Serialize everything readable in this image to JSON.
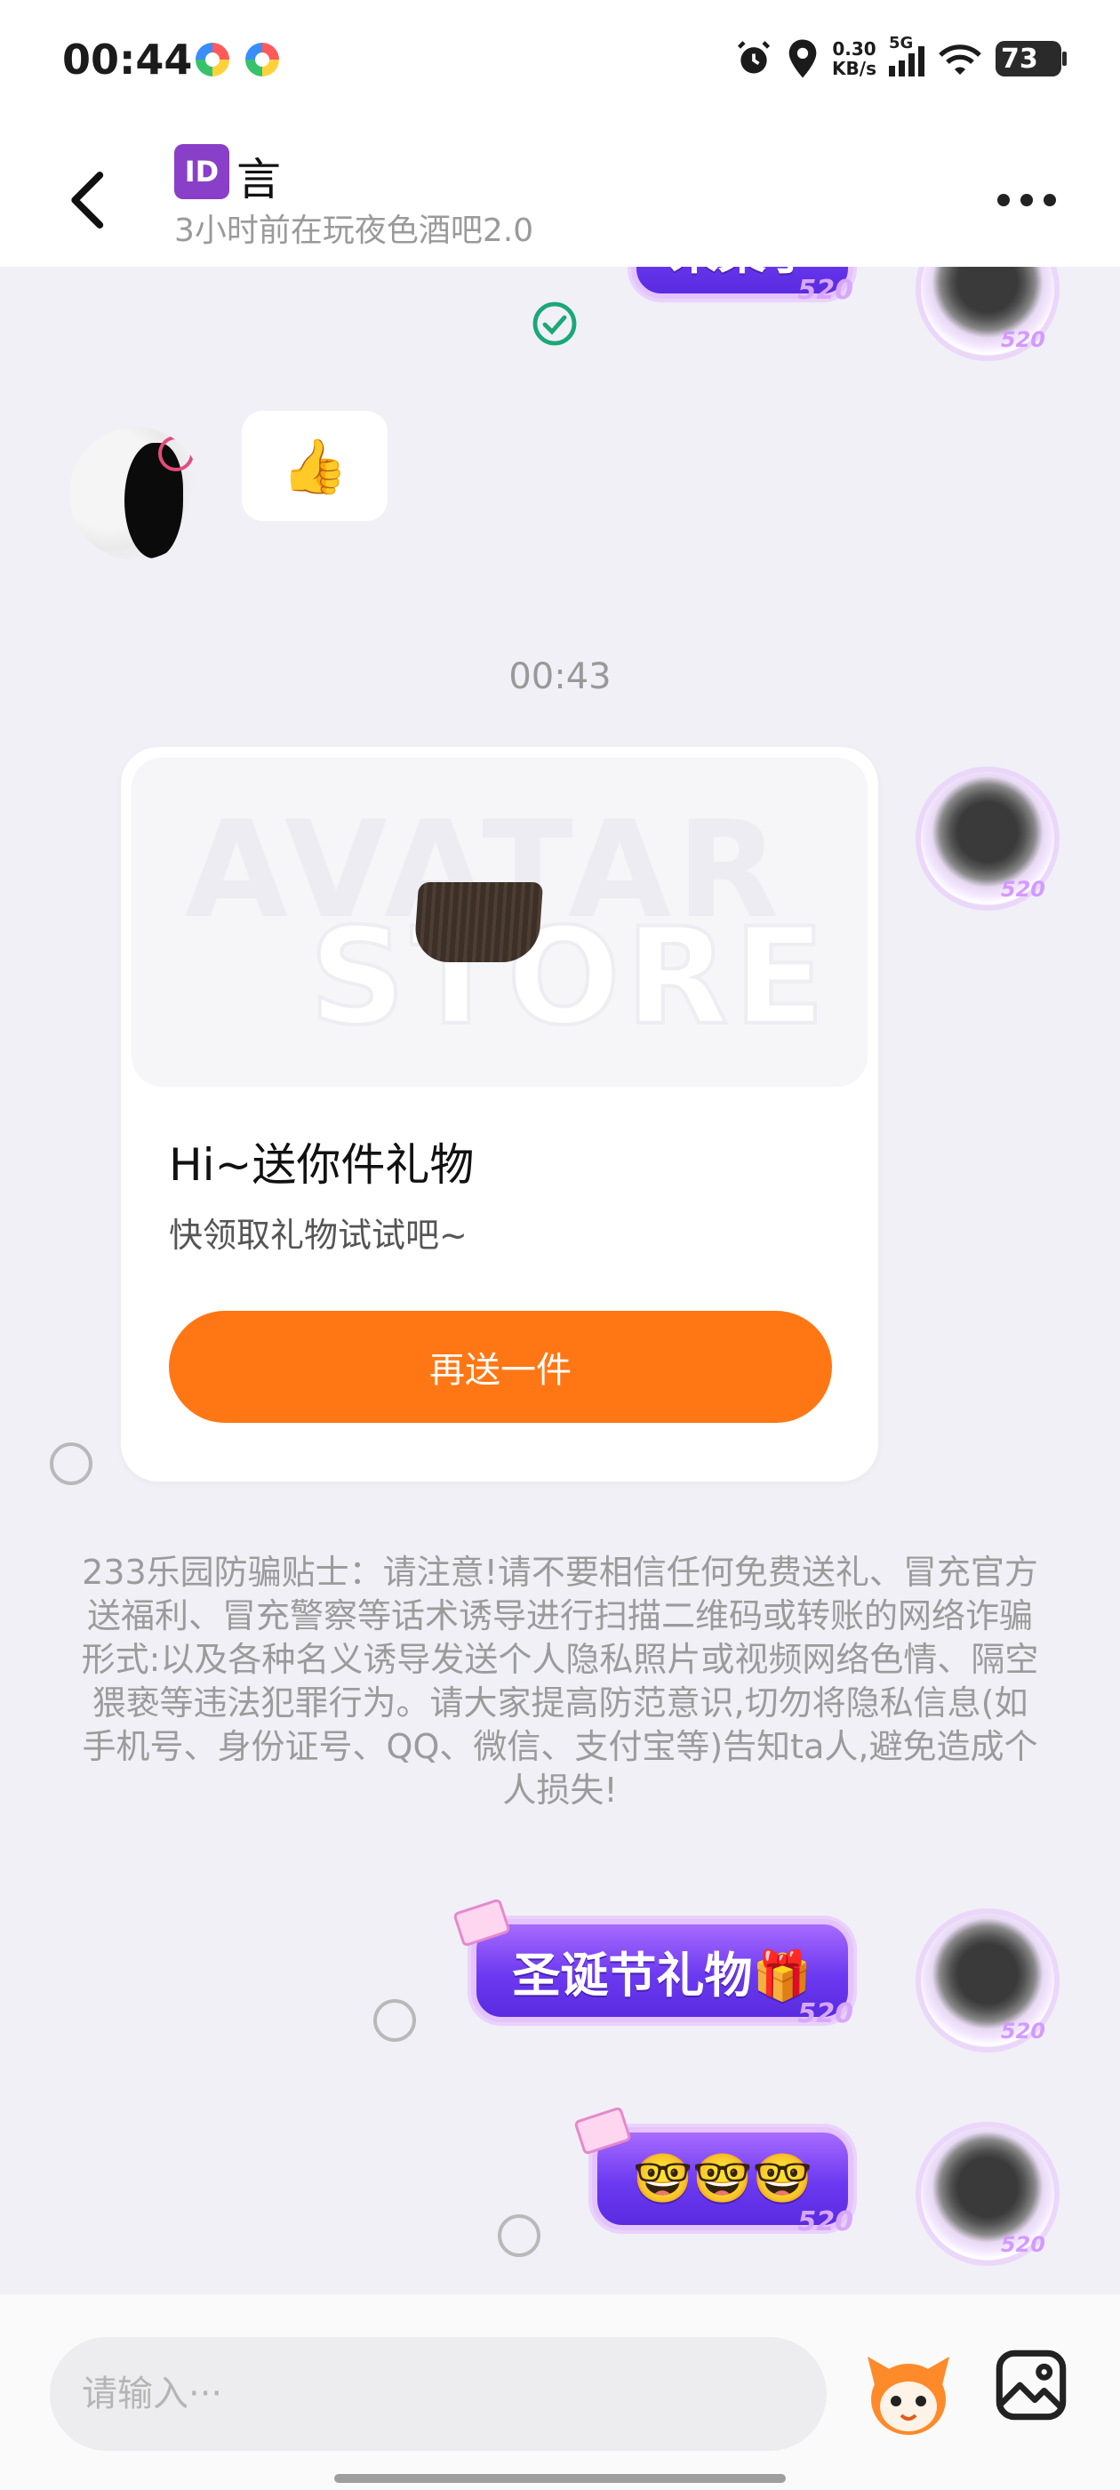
{
  "status_bar": {
    "time": "00:44",
    "net_speed_value": "0.30",
    "net_speed_unit": "KB/s",
    "network_type": "5G",
    "battery": "73"
  },
  "header": {
    "id_badge": "ID",
    "name": "言",
    "subtitle": "3小时前在玩夜色酒吧2.0"
  },
  "messages": {
    "top_pill_partial": "来菜了",
    "thumbs_up": "👍",
    "timestamp": "00:43",
    "gift_card": {
      "watermark_line1": "AVATAR",
      "watermark_line2": "STORE",
      "title": "Hi~送你件礼物",
      "subtitle": "快领取礼物试试吧~",
      "button": "再送一件"
    },
    "anti_fraud_tip": "233乐园防骗贴士：请注意!请不要相信任何免费送礼、冒充官方送福利、冒充警察等话术诱导进行扫描二维码或转账的网络诈骗形式:以及各种名义诱导发送个人隐私照片或视频网络色情、隔空猥亵等违法犯罪行为。请大家提高防范意识,切勿将隐私信息(如手机号、身份证号、QQ、微信、支付宝等)告知ta人,避免造成个人损失!",
    "gift_pill_1": "圣诞节礼物🎁",
    "gift_pill_2": "🤓🤓🤓"
  },
  "input": {
    "placeholder": "请输入···"
  },
  "icons": {
    "back": "chevron-left-icon",
    "more": "more-dots-icon",
    "sent": "check-circle-icon",
    "mascot": "mascot-icon",
    "gallery": "image-icon"
  },
  "colors": {
    "accent_orange": "#ff7714",
    "bubble_purple": "#6b39f0",
    "check_green": "#1aa876"
  }
}
